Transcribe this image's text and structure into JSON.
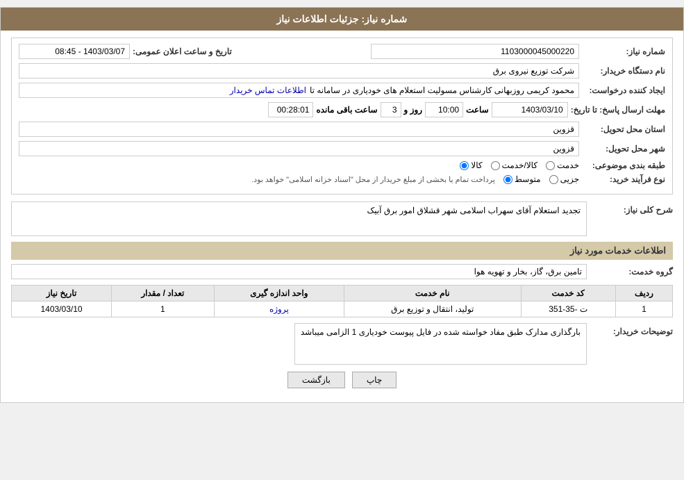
{
  "page": {
    "title": "جزئیات اطلاعات نیاز",
    "sections": {
      "main_info": {
        "label_shomara": "شماره نیاز:",
        "shomara_value": "1103000045000220",
        "label_name_org": "نام دستگاه خریدار:",
        "name_org_value": "شرکت توزیع نیروی برق",
        "label_creator": "ایجاد کننده درخواست:",
        "creator_value": "محمود کریمی روزبهانی کارشناس  مسولیت استعلام های خودیاری در سامانه تا",
        "creator_link": "اطلاعات تماس خریدار",
        "label_deadline": "مهلت ارسال پاسخ: تا تاریخ:",
        "date_value": "1403/03/10",
        "time_label": "ساعت",
        "time_value": "10:00",
        "days_label": "روز و",
        "days_value": "3",
        "remaining_label": "ساعت باقی مانده",
        "remaining_value": "00:28:01",
        "label_province": "استان محل تحویل:",
        "province_value": "قزوین",
        "label_city": "شهر محل تحویل:",
        "city_value": "قزوین",
        "label_category": "طبقه بندی موضوعی:",
        "cat_options": [
          "خدمت",
          "کالا/خدمت",
          "کالا"
        ],
        "cat_selected": "کالا",
        "label_purchase_type": "نوع فرآیند خرید:",
        "purchase_options": [
          "جزیی",
          "متوسط"
        ],
        "purchase_note": "پرداخت تمام یا بخشی از مبلغ خریدار از محل \"اسناد خزانه اسلامی\" خواهد بود.",
        "announce_label": "تاریخ و ساعت اعلان عمومی:",
        "announce_value": "1403/03/07 - 08:45"
      },
      "description": {
        "section_title": "شرح کلی نیاز:",
        "text": "تجدید استعلام  آقای سهراب اسلامی شهر قشلاق امور برق آبیک"
      },
      "services": {
        "section_title": "اطلاعات خدمات مورد نیاز",
        "group_label": "گروه خدمت:",
        "group_value": "تامین برق، گاز، بخار و تهویه هوا",
        "table": {
          "headers": [
            "ردیف",
            "کد خدمت",
            "نام خدمت",
            "واحد اندازه گیری",
            "تعداد / مقدار",
            "تاریخ نیاز"
          ],
          "rows": [
            {
              "row_num": "1",
              "code": "ت -35-351",
              "name": "تولید، انتقال و توزیع برق",
              "unit": "پروژه",
              "quantity": "1",
              "date": "1403/03/10"
            }
          ]
        }
      },
      "buyer_notes": {
        "label": "توضیحات خریدار:",
        "text": "بارگذاری مدارک طبق مفاد خواسته شده در فایل پیوست خودیاری 1 الزامی میباشد"
      },
      "buttons": {
        "print": "چاپ",
        "back": "بازگشت"
      }
    }
  }
}
